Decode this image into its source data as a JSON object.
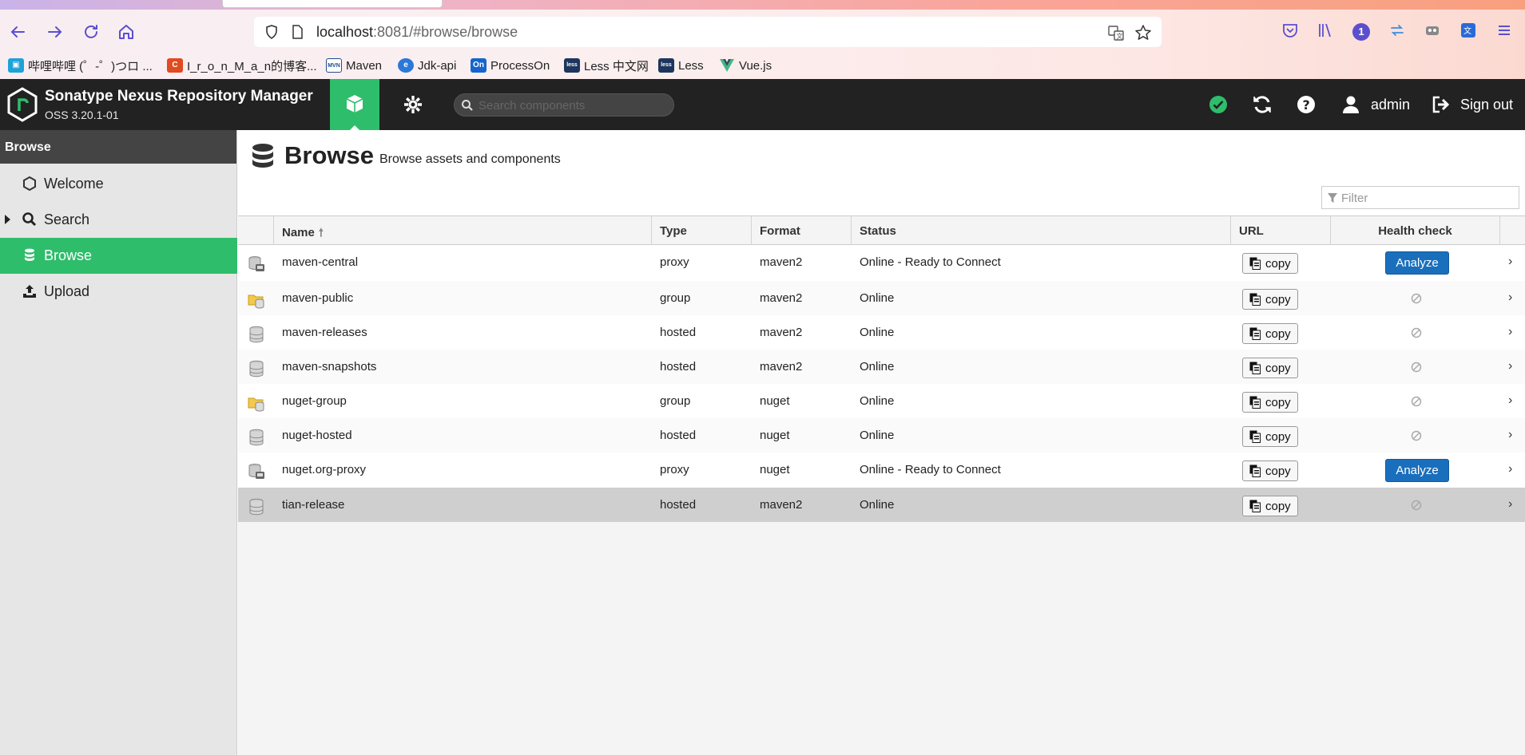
{
  "browser": {
    "url_host": "localhost",
    "url_rest": ":8081/#browse/browse",
    "badge_count": "1",
    "bookmarks": [
      {
        "label": "哔哩哔哩 (゜-゜)つロ ...",
        "color": "#1fa1d9",
        "glyph": "b"
      },
      {
        "label": "I_r_o_n_M_a_n的博客...",
        "color": "#e04b1f",
        "glyph": "C"
      },
      {
        "label": "Maven",
        "color": "#1d4d8f",
        "glyph": "MVN"
      },
      {
        "label": "Jdk-api",
        "color": "#2a79d8",
        "glyph": "e"
      },
      {
        "label": "ProcessOn",
        "color": "#1466cc",
        "glyph": "On"
      },
      {
        "label": "Less 中文网",
        "color": "#1d365d",
        "glyph": "less"
      },
      {
        "label": "Less",
        "color": "#1d365d",
        "glyph": "less"
      },
      {
        "label": "Vue.js",
        "color": "#41b883",
        "glyph": "V"
      }
    ]
  },
  "header": {
    "title": "Sonatype Nexus Repository Manager",
    "version": "OSS 3.20.1-01",
    "search_placeholder": "Search components",
    "user": "admin",
    "signout": "Sign out"
  },
  "sidebar": {
    "title": "Browse",
    "items": [
      {
        "label": "Welcome",
        "icon": "hexagon-icon"
      },
      {
        "label": "Search",
        "icon": "search-icon"
      },
      {
        "label": "Browse",
        "icon": "database-icon"
      },
      {
        "label": "Upload",
        "icon": "upload-icon"
      }
    ]
  },
  "page": {
    "title": "Browse",
    "subtitle": "Browse assets and components",
    "filter_placeholder": "Filter"
  },
  "table": {
    "columns": [
      "Name",
      "Type",
      "Format",
      "Status",
      "URL",
      "Health check"
    ],
    "copy_label": "copy",
    "analyze_label": "Analyze",
    "rows": [
      {
        "name": "maven-central",
        "type": "proxy",
        "format": "maven2",
        "status": "Online - Ready to Connect",
        "health": "analyze"
      },
      {
        "name": "maven-public",
        "type": "group",
        "format": "maven2",
        "status": "Online",
        "health": "na"
      },
      {
        "name": "maven-releases",
        "type": "hosted",
        "format": "maven2",
        "status": "Online",
        "health": "na"
      },
      {
        "name": "maven-snapshots",
        "type": "hosted",
        "format": "maven2",
        "status": "Online",
        "health": "na"
      },
      {
        "name": "nuget-group",
        "type": "group",
        "format": "nuget",
        "status": "Online",
        "health": "na"
      },
      {
        "name": "nuget-hosted",
        "type": "hosted",
        "format": "nuget",
        "status": "Online",
        "health": "na"
      },
      {
        "name": "nuget.org-proxy",
        "type": "proxy",
        "format": "nuget",
        "status": "Online - Ready to Connect",
        "health": "analyze"
      },
      {
        "name": "tian-release",
        "type": "hosted",
        "format": "maven2",
        "status": "Online",
        "health": "na"
      }
    ]
  },
  "colors": {
    "accent": "#2ebd6b",
    "header_bg": "#222222",
    "analyze_blue": "#1a6fbd"
  }
}
